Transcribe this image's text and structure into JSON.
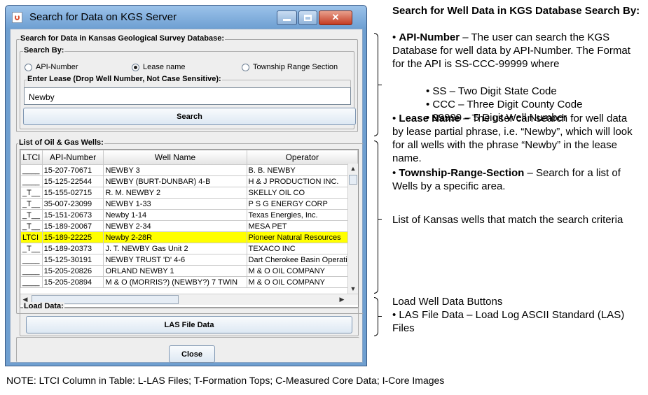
{
  "window": {
    "title": "Search for Data on KGS Server",
    "icon": "java-cup-icon"
  },
  "search_group": {
    "label": "Search for Data in Kansas Geological Survey Database:",
    "search_by_label": "Search By:",
    "options": [
      "API-Number",
      "Lease name",
      "Township Range Section"
    ],
    "selected_option": "Lease name",
    "lease_label": "Enter Lease (Drop Well Number, Not Case Sensitive):",
    "lease_value": "Newby",
    "search_button": "Search"
  },
  "wells_group": {
    "label": "List of Oil & Gas Wells:",
    "columns": [
      "LTCI",
      "API-Number",
      "Well Name",
      "Operator"
    ],
    "rows": [
      {
        "ltci": "____",
        "api": "15-207-70671",
        "name": "NEWBY 3",
        "operator": "B. B. NEWBY"
      },
      {
        "ltci": "____",
        "api": "15-125-22544",
        "name": "NEWBY (BURT-DUNBAR) 4-B",
        "operator": "H & J PRODUCTION INC."
      },
      {
        "ltci": "_T__",
        "api": "15-155-02715",
        "name": "R. M. NEWBY 2",
        "operator": "SKELLY OIL CO"
      },
      {
        "ltci": "_T__",
        "api": "35-007-23099",
        "name": "NEWBY 1-33",
        "operator": "P S G ENERGY CORP"
      },
      {
        "ltci": "_T__",
        "api": "15-151-20673",
        "name": "Newby 1-14",
        "operator": "Texas Energies, Inc."
      },
      {
        "ltci": "_T__",
        "api": "15-189-20067",
        "name": "NEWBY 2-34",
        "operator": "MESA PET"
      },
      {
        "ltci": "LTCI",
        "api": "15-189-22225",
        "name": "Newby 2-28R",
        "operator": "Pioneer Natural Resources"
      },
      {
        "ltci": "_T__",
        "api": "15-189-20373",
        "name": "J. T. NEWBY Gas Unit 2",
        "operator": "TEXACO INC"
      },
      {
        "ltci": "____",
        "api": "15-125-30191",
        "name": "NEWBY TRUST 'D' 4-6",
        "operator": "Dart Cherokee Basin Operating"
      },
      {
        "ltci": "____",
        "api": "15-205-20826",
        "name": "ORLAND NEWBY 1",
        "operator": "M & O OIL COMPANY"
      },
      {
        "ltci": "____",
        "api": "15-205-20894",
        "name": "M & O (MORRIS?) (NEWBY?) 7 TWIN",
        "operator": "M & O OIL COMPANY"
      }
    ],
    "selected_row": 6,
    "selected_color": "#ffff00"
  },
  "load_group": {
    "label": "Load Data:",
    "las_button": "LAS File Data"
  },
  "close_button": "Close",
  "annotations": {
    "search_heading": "Search for Well Data in KGS Database Search By:",
    "api_title": "API-Number",
    "api_text": " – The user can search the KGS Database for well data by API-Number.  The Format for the API is SS-CCC-99999 where",
    "api_sub": [
      "SS – Two Digit State Code",
      "CCC – Three Digit County Code",
      "99999 – 5 Digit Well Number"
    ],
    "lease_title": "Lease Name",
    "lease_text": " – The user can search for well data by lease partial phrase, i.e. “Newby”, which will look for all wells with the phrase “Newby” in the lease name.",
    "trs_title": "Township-Range-Section",
    "trs_text": " – Search for a list of Wells by a specific area.",
    "list_note": "List of Kansas wells that match the search criteria",
    "load_heading": "Load Well Data Buttons",
    "load_text": "LAS File Data – Load Log ASCII Standard (LAS) Files",
    "footer_note": "NOTE: LTCI Column in Table: L-LAS Files; T-Formation Tops; C-Measured Core Data; I-Core Images"
  }
}
